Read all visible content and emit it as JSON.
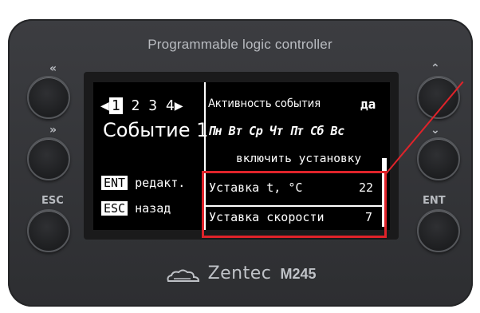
{
  "device": {
    "title": "Programmable logic controller",
    "brand": "Zentec",
    "model": "M245",
    "left_buttons": [
      "«",
      "»",
      "ESC"
    ],
    "right_buttons": [
      "≈",
      "≈",
      "ENT"
    ]
  },
  "screen": {
    "tabs": [
      "◀",
      "1",
      "2",
      "3",
      "4",
      "▶"
    ],
    "event_title": "Событие 1",
    "hints": [
      {
        "key": "ENT",
        "label": "редакт."
      },
      {
        "key": "ESC",
        "label": "назад"
      }
    ],
    "activity_label": "Активность события",
    "activity_value": "да",
    "days": "Пн Вт Ср Чт Пт Сб Вс",
    "enable_setting": "включить установку",
    "setpoint_temp_label": "Уставка t, °C",
    "setpoint_temp_value": "22",
    "setpoint_speed_label": "Уставка скорости",
    "setpoint_speed_value": "7"
  },
  "colors": {
    "highlight": "#e0232a"
  }
}
